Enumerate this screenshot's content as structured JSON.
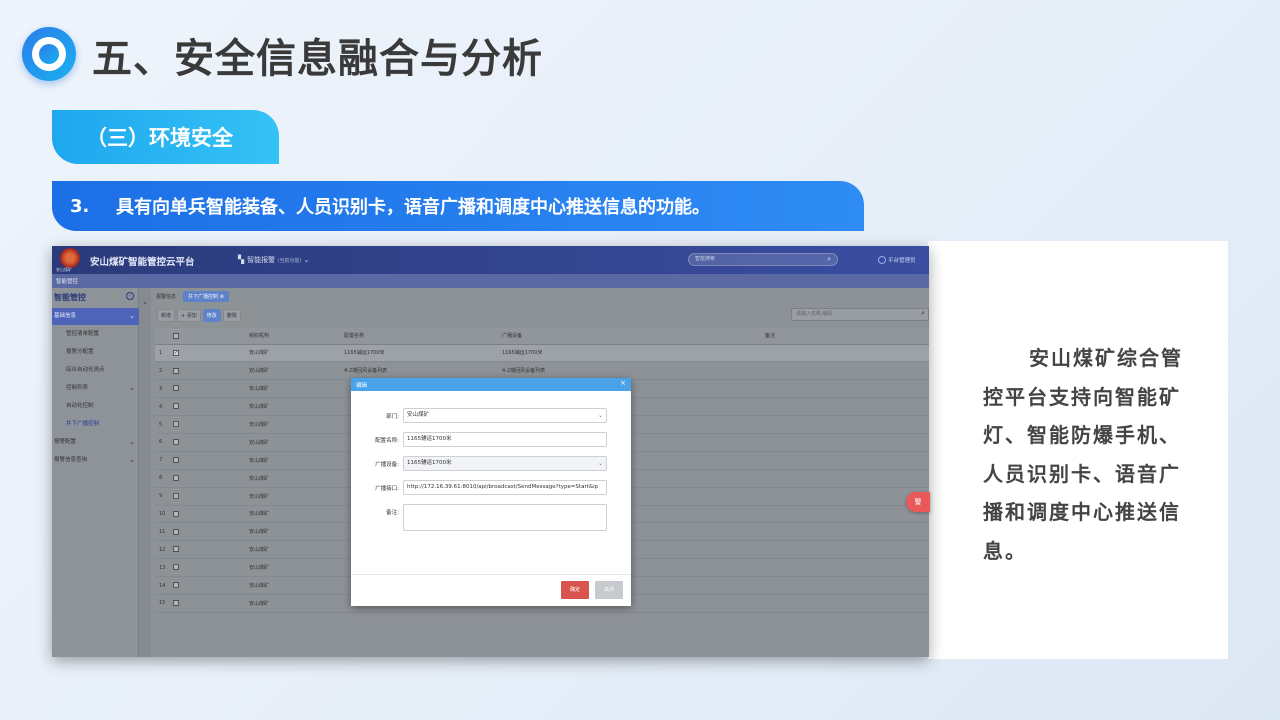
{
  "slide": {
    "title": "五、安全信息融合与分析",
    "section": "（三）环境安全",
    "item_number": "3.",
    "item_text": "具有向单兵智能装备、人员识别卡，语音广播和调度中心推送信息的功能。",
    "description": "安山煤矿综合管控平台支持向智能矿灯、智能防爆手机、人员识别卡、语音广播和调度中心推送信息。"
  },
  "app": {
    "name": "安山煤矿智能管控云平台",
    "emblem_sub": "安山煤矿",
    "module": "智能报警",
    "module_sub": "(当前功能)",
    "top_search_placeholder": "智能搜索",
    "user": "平台管理员",
    "crumb": "智能管控",
    "sidebar": {
      "header": "智能管控",
      "items": [
        {
          "label": "基础信息",
          "type": "group-active"
        },
        {
          "label": "管控清单配置",
          "type": "sub"
        },
        {
          "label": "报警分配置",
          "type": "sub"
        },
        {
          "label": "综合自动化测点",
          "type": "sub"
        },
        {
          "label": "控制列表",
          "type": "sub-group"
        },
        {
          "label": "自动化控制",
          "type": "sub2"
        },
        {
          "label": "井下广播控制",
          "type": "sub2-active"
        },
        {
          "label": "报警配置",
          "type": "group"
        },
        {
          "label": "报警信息查询",
          "type": "group"
        }
      ]
    },
    "tabs": [
      "报警信息",
      "井下广播控制 ⊗"
    ],
    "toolbar": [
      "新增",
      "+ 添加",
      "修改",
      "删除"
    ],
    "main_search_placeholder": "请输入名称,编码",
    "table": {
      "headers": [
        "",
        "",
        "组织机构",
        "配置名称",
        "广播设备",
        "备注"
      ],
      "rows": [
        {
          "no": "1",
          "org": "安山煤矿",
          "name": "1165辅运1700米",
          "device": "1165辅运1700米",
          "checked": true
        },
        {
          "no": "2",
          "org": "安山煤矿",
          "name": "4-2煤回风设备列表",
          "device": "4-2煤回风设备列表",
          "checked": false
        },
        {
          "no": "3",
          "org": "安山煤矿",
          "name": "",
          "device": "",
          "checked": false
        },
        {
          "no": "4",
          "org": "安山煤矿",
          "name": "",
          "device": "",
          "checked": false
        },
        {
          "no": "5",
          "org": "安山煤矿",
          "name": "",
          "device": "",
          "checked": false
        },
        {
          "no": "6",
          "org": "安山煤矿",
          "name": "",
          "device": "",
          "checked": false
        },
        {
          "no": "7",
          "org": "安山煤矿",
          "name": "",
          "device": "",
          "checked": false
        },
        {
          "no": "8",
          "org": "安山煤矿",
          "name": "",
          "device": "",
          "checked": false
        },
        {
          "no": "9",
          "org": "安山煤矿",
          "name": "",
          "device": "",
          "checked": false
        },
        {
          "no": "10",
          "org": "安山煤矿",
          "name": "",
          "device": "",
          "checked": false
        },
        {
          "no": "11",
          "org": "安山煤矿",
          "name": "",
          "device": "",
          "checked": false
        },
        {
          "no": "12",
          "org": "安山煤矿",
          "name": "",
          "device": "",
          "checked": false
        },
        {
          "no": "13",
          "org": "安山煤矿",
          "name": "",
          "device": "",
          "checked": false
        },
        {
          "no": "14",
          "org": "安山煤矿",
          "name": "",
          "device": "",
          "checked": false
        },
        {
          "no": "15",
          "org": "安山煤矿",
          "name": "",
          "device": "",
          "checked": false
        }
      ]
    },
    "modal": {
      "title": "编辑",
      "fields": [
        {
          "label": "部门:",
          "value": "安山煤矿",
          "kind": "select"
        },
        {
          "label": "配置名称:",
          "value": "1165辅运1700米",
          "kind": "text"
        },
        {
          "label": "广播设备:",
          "value": "1165辅运1700米",
          "kind": "select"
        },
        {
          "label": "广播接口:",
          "value": "http://172.16.39.61:8010/api/broadcast/SendMessage?type=Start&ip",
          "kind": "text"
        },
        {
          "label": "备注:",
          "value": "",
          "kind": "area"
        }
      ],
      "ok": "确定",
      "cancel": "关闭"
    },
    "side_pill": "警"
  },
  "colors": {
    "accent_blue": "#1c6fe6",
    "accent_cyan": "#1ea7ee",
    "modal_ok": "#d9534f"
  }
}
